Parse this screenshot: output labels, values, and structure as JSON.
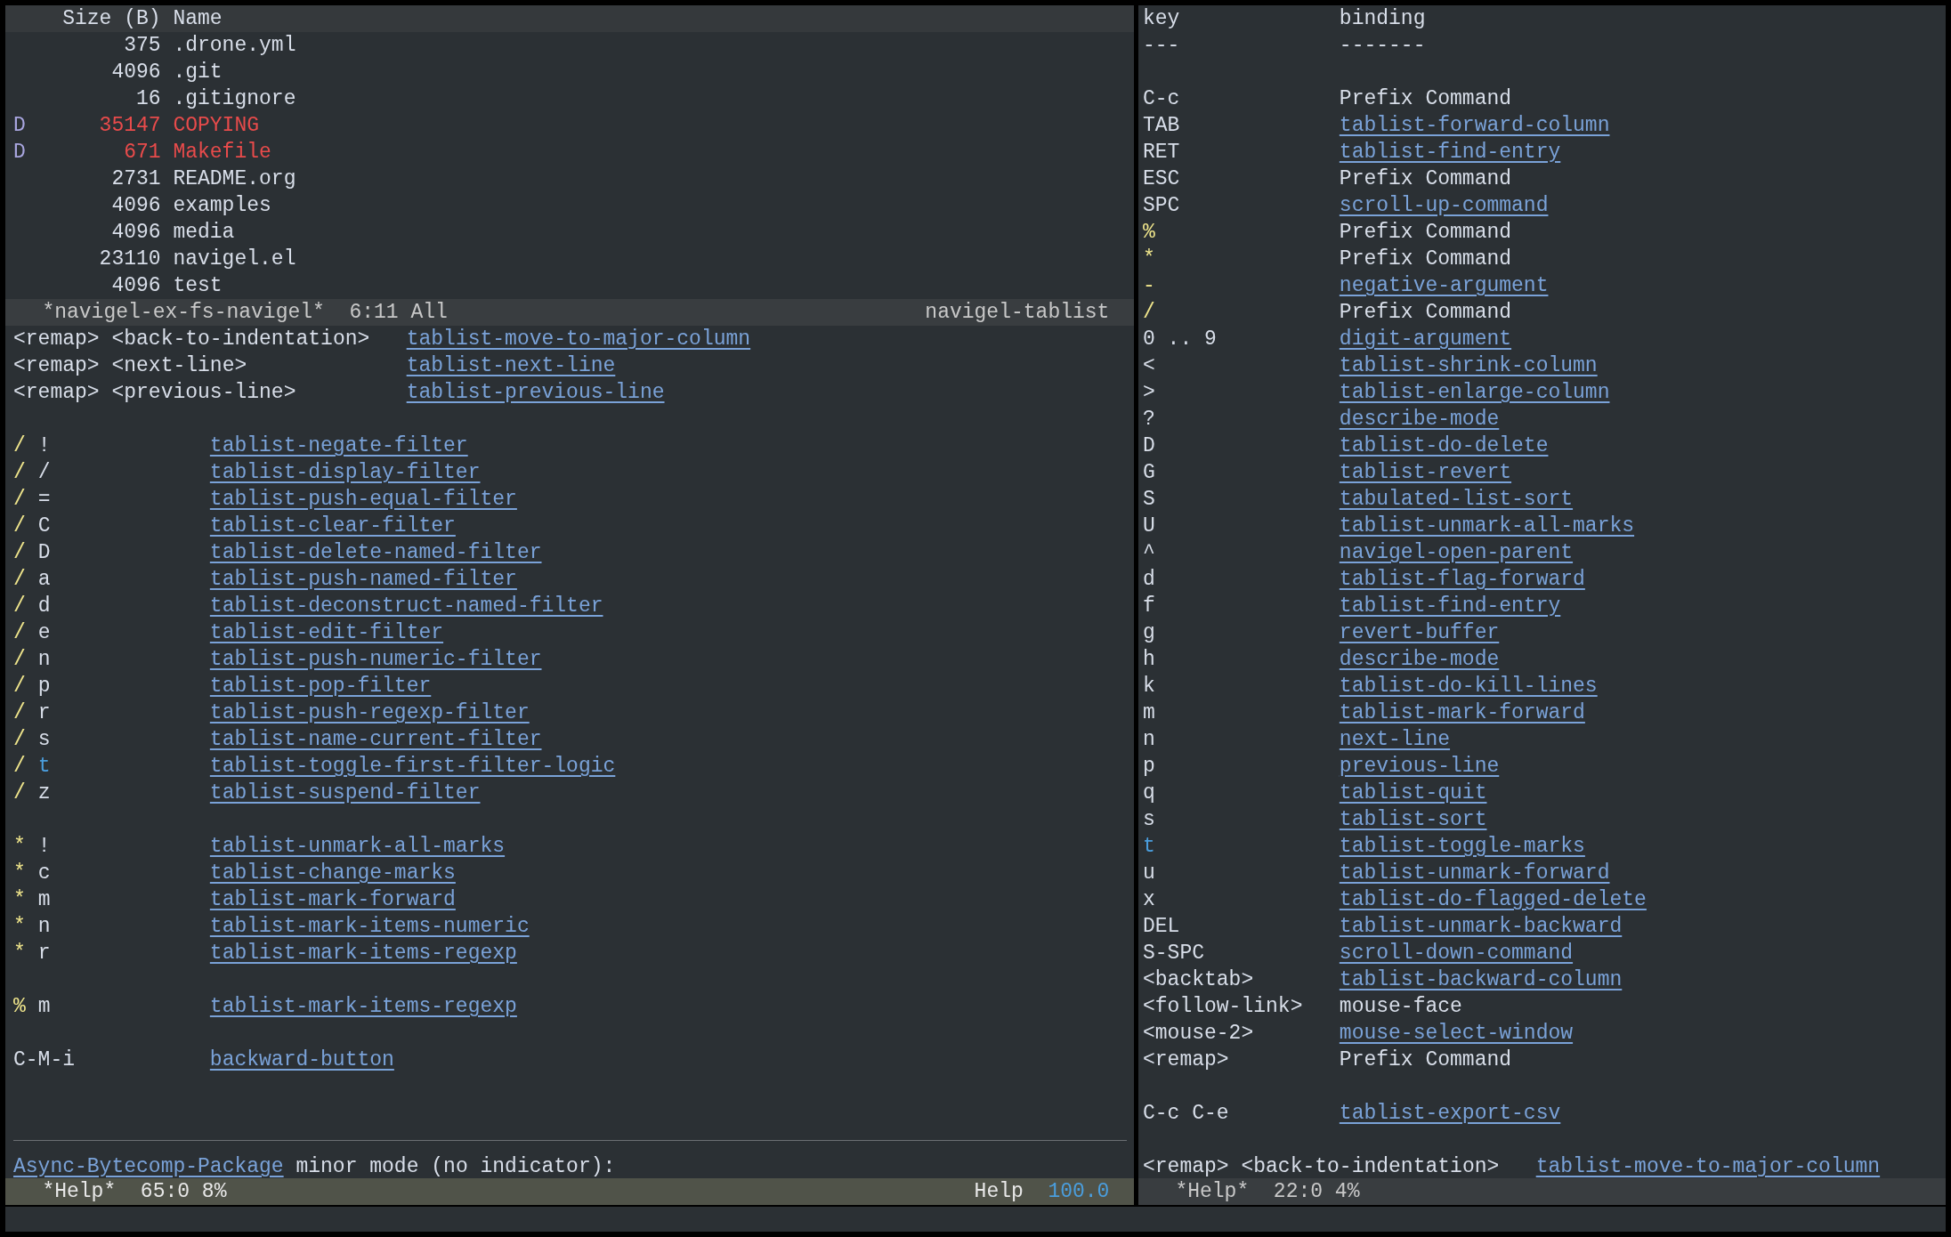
{
  "file_window": {
    "header": {
      "size": "Size (B)",
      "name": "Name"
    },
    "rows": [
      {
        "mark": "",
        "size": "375",
        "name": ".drone.yml",
        "flagged": false
      },
      {
        "size": "4096",
        "name": ".git",
        "flagged": false
      },
      {
        "size": "16",
        "name": ".gitignore",
        "flagged": false
      },
      {
        "mark": "D",
        "size": "35147",
        "name": "COPYING",
        "flagged": true
      },
      {
        "mark": "D",
        "size": "671",
        "name": "Makefile",
        "flagged": true
      },
      {
        "size": "2731",
        "name": "README.org",
        "flagged": false
      },
      {
        "size": "4096",
        "name": "examples",
        "flagged": false
      },
      {
        "size": "4096",
        "name": "media",
        "flagged": false
      },
      {
        "size": "23110",
        "name": "navigel.el",
        "flagged": false
      },
      {
        "size": "4096",
        "name": "test",
        "flagged": false
      }
    ],
    "mode_line": {
      "active": false,
      "buffer": "*navigel-ex-fs-navigel*",
      "position": "6:11",
      "scroll": "All",
      "mode": "navigel-tablist"
    }
  },
  "help_window_left": {
    "lines": [
      {
        "kind": "binding",
        "key": [
          {
            "text": "<remap>",
            "kind": "plain"
          },
          {
            "text": "<back-to-indentation>",
            "kind": "plain"
          }
        ],
        "binding": {
          "text": "tablist-move-to-major-column",
          "link": true
        }
      },
      {
        "kind": "binding",
        "key": [
          {
            "text": "<remap>",
            "kind": "plain"
          },
          {
            "text": "<next-line>",
            "kind": "plain"
          }
        ],
        "binding": {
          "text": "tablist-next-line",
          "link": true
        }
      },
      {
        "kind": "binding",
        "key": [
          {
            "text": "<remap>",
            "kind": "plain"
          },
          {
            "text": "<previous-line>",
            "kind": "plain"
          }
        ],
        "binding": {
          "text": "tablist-previous-line",
          "link": true
        }
      },
      {
        "kind": "blank"
      },
      {
        "kind": "binding",
        "key": [
          {
            "text": "/",
            "kind": "prefix"
          },
          {
            "text": "!",
            "kind": "plain"
          }
        ],
        "binding": {
          "text": "tablist-negate-filter",
          "link": true
        }
      },
      {
        "kind": "binding",
        "key": [
          {
            "text": "/",
            "kind": "prefix"
          },
          {
            "text": "/",
            "kind": "plain"
          }
        ],
        "binding": {
          "text": "tablist-display-filter",
          "link": true
        }
      },
      {
        "kind": "binding",
        "key": [
          {
            "text": "/",
            "kind": "prefix"
          },
          {
            "text": "=",
            "kind": "plain"
          }
        ],
        "binding": {
          "text": "tablist-push-equal-filter",
          "link": true
        }
      },
      {
        "kind": "binding",
        "key": [
          {
            "text": "/",
            "kind": "prefix"
          },
          {
            "text": "C",
            "kind": "plain"
          }
        ],
        "binding": {
          "text": "tablist-clear-filter",
          "link": true
        }
      },
      {
        "kind": "binding",
        "key": [
          {
            "text": "/",
            "kind": "prefix"
          },
          {
            "text": "D",
            "kind": "plain"
          }
        ],
        "binding": {
          "text": "tablist-delete-named-filter",
          "link": true
        }
      },
      {
        "kind": "binding",
        "key": [
          {
            "text": "/",
            "kind": "prefix"
          },
          {
            "text": "a",
            "kind": "plain"
          }
        ],
        "binding": {
          "text": "tablist-push-named-filter",
          "link": true
        }
      },
      {
        "kind": "binding",
        "key": [
          {
            "text": "/",
            "kind": "prefix"
          },
          {
            "text": "d",
            "kind": "plain"
          }
        ],
        "binding": {
          "text": "tablist-deconstruct-named-filter",
          "link": true
        }
      },
      {
        "kind": "binding",
        "key": [
          {
            "text": "/",
            "kind": "prefix"
          },
          {
            "text": "e",
            "kind": "plain"
          }
        ],
        "binding": {
          "text": "tablist-edit-filter",
          "link": true
        }
      },
      {
        "kind": "binding",
        "key": [
          {
            "text": "/",
            "kind": "prefix"
          },
          {
            "text": "n",
            "kind": "plain"
          }
        ],
        "binding": {
          "text": "tablist-push-numeric-filter",
          "link": true
        }
      },
      {
        "kind": "binding",
        "key": [
          {
            "text": "/",
            "kind": "prefix"
          },
          {
            "text": "p",
            "kind": "plain"
          }
        ],
        "binding": {
          "text": "tablist-pop-filter",
          "link": true
        }
      },
      {
        "kind": "binding",
        "key": [
          {
            "text": "/",
            "kind": "prefix"
          },
          {
            "text": "r",
            "kind": "plain"
          }
        ],
        "binding": {
          "text": "tablist-push-regexp-filter",
          "link": true
        }
      },
      {
        "kind": "binding",
        "key": [
          {
            "text": "/",
            "kind": "prefix"
          },
          {
            "text": "s",
            "kind": "plain"
          }
        ],
        "binding": {
          "text": "tablist-name-current-filter",
          "link": true
        }
      },
      {
        "kind": "binding",
        "key": [
          {
            "text": "/",
            "kind": "prefix"
          },
          {
            "text": "t",
            "kind": "special"
          }
        ],
        "binding": {
          "text": "tablist-toggle-first-filter-logic",
          "link": true
        }
      },
      {
        "kind": "binding",
        "key": [
          {
            "text": "/",
            "kind": "prefix"
          },
          {
            "text": "z",
            "kind": "plain"
          }
        ],
        "binding": {
          "text": "tablist-suspend-filter",
          "link": true
        }
      },
      {
        "kind": "blank"
      },
      {
        "kind": "binding",
        "key": [
          {
            "text": "*",
            "kind": "prefix"
          },
          {
            "text": "!",
            "kind": "plain"
          }
        ],
        "binding": {
          "text": "tablist-unmark-all-marks",
          "link": true
        }
      },
      {
        "kind": "binding",
        "key": [
          {
            "text": "*",
            "kind": "prefix"
          },
          {
            "text": "c",
            "kind": "plain"
          }
        ],
        "binding": {
          "text": "tablist-change-marks",
          "link": true
        }
      },
      {
        "kind": "binding",
        "key": [
          {
            "text": "*",
            "kind": "prefix"
          },
          {
            "text": "m",
            "kind": "plain"
          }
        ],
        "binding": {
          "text": "tablist-mark-forward",
          "link": true
        }
      },
      {
        "kind": "binding",
        "key": [
          {
            "text": "*",
            "kind": "prefix"
          },
          {
            "text": "n",
            "kind": "plain"
          }
        ],
        "binding": {
          "text": "tablist-mark-items-numeric",
          "link": true
        }
      },
      {
        "kind": "binding",
        "key": [
          {
            "text": "*",
            "kind": "prefix"
          },
          {
            "text": "r",
            "kind": "plain"
          }
        ],
        "binding": {
          "text": "tablist-mark-items-regexp",
          "link": true
        }
      },
      {
        "kind": "blank"
      },
      {
        "kind": "binding",
        "key": [
          {
            "text": "%",
            "kind": "prefix"
          },
          {
            "text": "m",
            "kind": "plain"
          }
        ],
        "binding": {
          "text": "tablist-mark-items-regexp",
          "link": true
        }
      },
      {
        "kind": "blank"
      },
      {
        "kind": "binding",
        "key": [
          {
            "text": "C-M-i",
            "kind": "plain"
          }
        ],
        "binding": {
          "text": "backward-button",
          "link": true
        }
      },
      {
        "kind": "blank"
      },
      {
        "kind": "blank"
      },
      {
        "kind": "rule"
      },
      {
        "kind": "heading",
        "link": "Async-Bytecomp-Package",
        "text": "minor mode (no indicator):"
      }
    ],
    "mode_line": {
      "active": true,
      "buffer": "*Help*",
      "position": "65:0",
      "scroll": "8%",
      "mode": "Help",
      "extra": "100.0"
    }
  },
  "help_window_right": {
    "lines": [
      {
        "kind": "binding",
        "key": [
          {
            "text": "key",
            "kind": "plain"
          }
        ],
        "binding": {
          "text": "binding",
          "link": false
        }
      },
      {
        "kind": "binding",
        "key": [
          {
            "text": "---",
            "kind": "plain"
          }
        ],
        "binding": {
          "text": "-------",
          "link": false
        }
      },
      {
        "kind": "blank"
      },
      {
        "kind": "binding",
        "key": [
          {
            "text": "C-c",
            "kind": "plain"
          }
        ],
        "binding": {
          "text": "Prefix Command",
          "link": false
        }
      },
      {
        "kind": "binding",
        "key": [
          {
            "text": "TAB",
            "kind": "plain"
          }
        ],
        "binding": {
          "text": "tablist-forward-column",
          "link": true
        }
      },
      {
        "kind": "binding",
        "key": [
          {
            "text": "RET",
            "kind": "plain"
          }
        ],
        "binding": {
          "text": "tablist-find-entry",
          "link": true
        }
      },
      {
        "kind": "binding",
        "key": [
          {
            "text": "ESC",
            "kind": "plain"
          }
        ],
        "binding": {
          "text": "Prefix Command",
          "link": false
        }
      },
      {
        "kind": "binding",
        "key": [
          {
            "text": "SPC",
            "kind": "plain"
          }
        ],
        "binding": {
          "text": "scroll-up-command",
          "link": true
        }
      },
      {
        "kind": "binding",
        "key": [
          {
            "text": "%",
            "kind": "prefix"
          }
        ],
        "binding": {
          "text": "Prefix Command",
          "link": false
        }
      },
      {
        "kind": "binding",
        "key": [
          {
            "text": "*",
            "kind": "prefix"
          }
        ],
        "binding": {
          "text": "Prefix Command",
          "link": false
        }
      },
      {
        "kind": "binding",
        "key": [
          {
            "text": "-",
            "kind": "prefix"
          }
        ],
        "binding": {
          "text": "negative-argument",
          "link": true
        }
      },
      {
        "kind": "binding",
        "key": [
          {
            "text": "/",
            "kind": "prefix"
          }
        ],
        "binding": {
          "text": "Prefix Command",
          "link": false
        }
      },
      {
        "kind": "binding",
        "key": [
          {
            "text": "0 .. 9",
            "kind": "plain"
          }
        ],
        "binding": {
          "text": "digit-argument",
          "link": true
        }
      },
      {
        "kind": "binding",
        "key": [
          {
            "text": "<",
            "kind": "plain"
          }
        ],
        "binding": {
          "text": "tablist-shrink-column",
          "link": true
        }
      },
      {
        "kind": "binding",
        "key": [
          {
            "text": ">",
            "kind": "plain"
          }
        ],
        "binding": {
          "text": "tablist-enlarge-column",
          "link": true
        }
      },
      {
        "kind": "binding",
        "key": [
          {
            "text": "?",
            "kind": "plain"
          }
        ],
        "binding": {
          "text": "describe-mode",
          "link": true
        }
      },
      {
        "kind": "binding",
        "key": [
          {
            "text": "D",
            "kind": "plain"
          }
        ],
        "binding": {
          "text": "tablist-do-delete",
          "link": true
        }
      },
      {
        "kind": "binding",
        "key": [
          {
            "text": "G",
            "kind": "plain"
          }
        ],
        "binding": {
          "text": "tablist-revert",
          "link": true
        }
      },
      {
        "kind": "binding",
        "key": [
          {
            "text": "S",
            "kind": "plain"
          }
        ],
        "binding": {
          "text": "tabulated-list-sort",
          "link": true
        }
      },
      {
        "kind": "binding",
        "key": [
          {
            "text": "U",
            "kind": "plain"
          }
        ],
        "binding": {
          "text": "tablist-unmark-all-marks",
          "link": true
        }
      },
      {
        "kind": "binding",
        "key": [
          {
            "text": "^",
            "kind": "plain"
          }
        ],
        "binding": {
          "text": "navigel-open-parent",
          "link": true
        }
      },
      {
        "kind": "binding",
        "key": [
          {
            "text": "d",
            "kind": "plain"
          }
        ],
        "binding": {
          "text": "tablist-flag-forward",
          "link": true
        }
      },
      {
        "kind": "binding",
        "key": [
          {
            "text": "f",
            "kind": "plain"
          }
        ],
        "binding": {
          "text": "tablist-find-entry",
          "link": true
        }
      },
      {
        "kind": "binding",
        "key": [
          {
            "text": "g",
            "kind": "plain"
          }
        ],
        "binding": {
          "text": "revert-buffer",
          "link": true
        }
      },
      {
        "kind": "binding",
        "key": [
          {
            "text": "h",
            "kind": "plain"
          }
        ],
        "binding": {
          "text": "describe-mode",
          "link": true
        }
      },
      {
        "kind": "binding",
        "key": [
          {
            "text": "k",
            "kind": "plain"
          }
        ],
        "binding": {
          "text": "tablist-do-kill-lines",
          "link": true
        }
      },
      {
        "kind": "binding",
        "key": [
          {
            "text": "m",
            "kind": "plain"
          }
        ],
        "binding": {
          "text": "tablist-mark-forward",
          "link": true
        }
      },
      {
        "kind": "binding",
        "key": [
          {
            "text": "n",
            "kind": "plain"
          }
        ],
        "binding": {
          "text": "next-line",
          "link": true
        }
      },
      {
        "kind": "binding",
        "key": [
          {
            "text": "p",
            "kind": "plain"
          }
        ],
        "binding": {
          "text": "previous-line",
          "link": true
        }
      },
      {
        "kind": "binding",
        "key": [
          {
            "text": "q",
            "kind": "plain"
          }
        ],
        "binding": {
          "text": "tablist-quit",
          "link": true
        }
      },
      {
        "kind": "binding",
        "key": [
          {
            "text": "s",
            "kind": "plain"
          }
        ],
        "binding": {
          "text": "tablist-sort",
          "link": true
        }
      },
      {
        "kind": "binding",
        "key": [
          {
            "text": "t",
            "kind": "special"
          }
        ],
        "binding": {
          "text": "tablist-toggle-marks",
          "link": true
        }
      },
      {
        "kind": "binding",
        "key": [
          {
            "text": "u",
            "kind": "plain"
          }
        ],
        "binding": {
          "text": "tablist-unmark-forward",
          "link": true
        }
      },
      {
        "kind": "binding",
        "key": [
          {
            "text": "x",
            "kind": "plain"
          }
        ],
        "binding": {
          "text": "tablist-do-flagged-delete",
          "link": true
        }
      },
      {
        "kind": "binding",
        "key": [
          {
            "text": "DEL",
            "kind": "plain"
          }
        ],
        "binding": {
          "text": "tablist-unmark-backward",
          "link": true
        }
      },
      {
        "kind": "binding",
        "key": [
          {
            "text": "S-SPC",
            "kind": "plain"
          }
        ],
        "binding": {
          "text": "scroll-down-command",
          "link": true
        }
      },
      {
        "kind": "binding",
        "key": [
          {
            "text": "<backtab>",
            "kind": "plain"
          }
        ],
        "binding": {
          "text": "tablist-backward-column",
          "link": true
        }
      },
      {
        "kind": "binding",
        "key": [
          {
            "text": "<follow-link>",
            "kind": "plain"
          }
        ],
        "binding": {
          "text": "mouse-face",
          "link": false
        }
      },
      {
        "kind": "binding",
        "key": [
          {
            "text": "<mouse-2>",
            "kind": "plain"
          }
        ],
        "binding": {
          "text": "mouse-select-window",
          "link": true
        }
      },
      {
        "kind": "binding",
        "key": [
          {
            "text": "<remap>",
            "kind": "plain"
          }
        ],
        "binding": {
          "text": "Prefix Command",
          "link": false
        }
      },
      {
        "kind": "blank"
      },
      {
        "kind": "binding",
        "key": [
          {
            "text": "C-c",
            "kind": "plain"
          },
          {
            "text": "C-e",
            "kind": "plain"
          }
        ],
        "binding": {
          "text": "tablist-export-csv",
          "link": true
        }
      },
      {
        "kind": "blank"
      },
      {
        "kind": "binding",
        "key": [
          {
            "text": "<remap>",
            "kind": "plain"
          },
          {
            "text": "<back-to-indentation>",
            "kind": "plain"
          }
        ],
        "binding": {
          "text": "tablist-move-to-major-column",
          "link": true
        }
      }
    ],
    "mode_line": {
      "active": false,
      "buffer": "*Help*",
      "position": "22:0",
      "scroll": "4%"
    }
  }
}
